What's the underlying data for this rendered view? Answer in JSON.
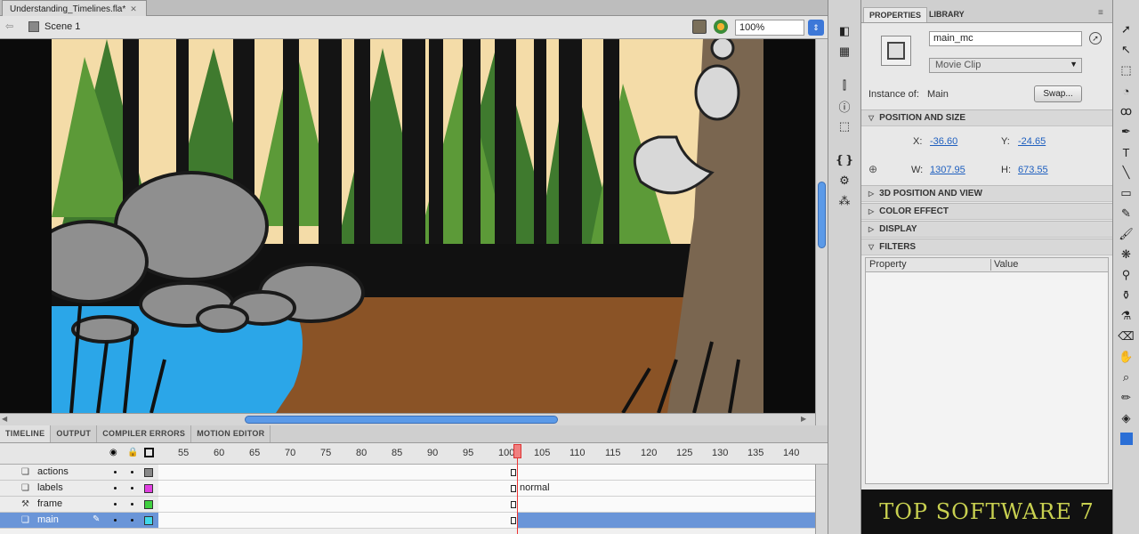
{
  "document": {
    "tab_title": "Understanding_Timelines.fla*",
    "scene": "Scene 1",
    "zoom": "100%"
  },
  "panel_tabs": [
    "PROPERTIES",
    "LIBRARY"
  ],
  "properties": {
    "instance_name": "main_mc",
    "symbol_type": "Movie Clip",
    "instance_of_label": "Instance of:",
    "instance_of_value": "Main",
    "swap_label": "Swap...",
    "sections": {
      "position_size": "POSITION AND SIZE",
      "pos3d": "3D POSITION AND VIEW",
      "color_effect": "COLOR EFFECT",
      "display": "DISPLAY",
      "filters": "FILTERS"
    },
    "x_label": "X:",
    "x_value": "-36.60",
    "y_label": "Y:",
    "y_value": "-24.65",
    "w_label": "W:",
    "w_value": "1307.95",
    "h_label": "H:",
    "h_value": "673.55",
    "filters_columns": [
      "Property",
      "Value"
    ]
  },
  "timeline": {
    "tabs": [
      "TIMELINE",
      "OUTPUT",
      "COMPILER ERRORS",
      "MOTION EDITOR"
    ],
    "ruler": [
      "55",
      "60",
      "65",
      "70",
      "75",
      "80",
      "85",
      "90",
      "95",
      "100",
      "105",
      "110",
      "115",
      "120",
      "125",
      "130",
      "135",
      "140"
    ],
    "layers": [
      {
        "name": "actions",
        "color": "#888888"
      },
      {
        "name": "labels",
        "color": "#e040e0"
      },
      {
        "name": "frame",
        "color": "#40d040"
      },
      {
        "name": "main",
        "color": "#40d8e8"
      }
    ],
    "frame_label": "normal",
    "playhead_frame": 100
  },
  "watermark": {
    "text": "TOP SOFTWARE 7"
  },
  "icons": [
    "hand-back-icon",
    "scene-icon",
    "edit-scene-icon",
    "edit-symbol-icon",
    "zoom-dropdown-icon",
    "eye-icon",
    "lock-icon",
    "outline-icon",
    "pencil-icon"
  ]
}
